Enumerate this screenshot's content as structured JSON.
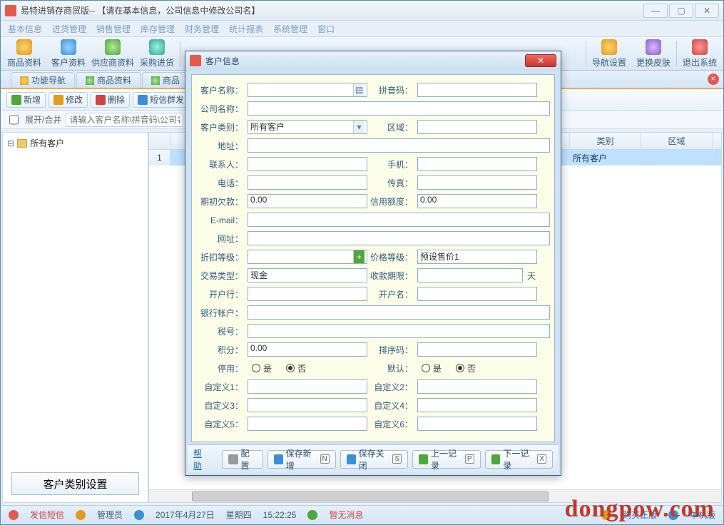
{
  "window": {
    "title": "易特进销存商贸版-- 【请在基本信息，公司信息中修改公司名】"
  },
  "menus": [
    "基本信息",
    "进货管理",
    "销售管理",
    "库存管理",
    "财务管理",
    "统计报表",
    "系统管理",
    "窗口"
  ],
  "toolbar": [
    {
      "label": "商品资料"
    },
    {
      "label": "客户资料"
    },
    {
      "label": "供应商资料"
    },
    {
      "label": "采购进货"
    },
    {
      "label": ""
    },
    {
      "label": ""
    },
    {
      "label": ""
    },
    {
      "label": ""
    },
    {
      "label": ""
    },
    {
      "label": ""
    },
    {
      "label": ""
    },
    {
      "label": "导航设置"
    },
    {
      "label": "更换皮肤"
    },
    {
      "label": "退出系统"
    }
  ],
  "tabs": [
    "功能导航",
    "商品资料",
    "商品"
  ],
  "subtool": {
    "add": "新增",
    "edit": "修改",
    "del": "删除",
    "sms": "短信群发"
  },
  "filter": {
    "expand": "展开/合并",
    "placeholder": "请输入客户名称\\拼音码\\公司名"
  },
  "tree": {
    "root": "所有客户",
    "button": "客户类别设置"
  },
  "grid": {
    "cols": [
      "",
      "",
      "",
      "",
      "类别",
      "区域"
    ],
    "row": {
      "idx": "1",
      "cat": "所有客户"
    }
  },
  "status": {
    "a": "发信短信",
    "b": "管理员",
    "date": "2017年4月27日",
    "week": "星期四",
    "time": "15:22:25",
    "msg": "暂无消息",
    "p1": "购买正版",
    "p2": "单机版"
  },
  "watermark": "dongpow.com",
  "dialog": {
    "title": "客户信息",
    "labels": {
      "name": "客户名称：",
      "pinyin": "拼音码：",
      "company": "公司名称：",
      "category": "客户类别：",
      "area": "区域：",
      "address": "地址：",
      "contact": "联系人：",
      "mobile": "手机：",
      "phone": "电话：",
      "fax": "传真：",
      "initdebt": "期初欠款：",
      "credit": "信用额度：",
      "email": "E-mail：",
      "url": "网址：",
      "discount": "折扣等级：",
      "pricelv": "价格等级：",
      "txtype": "交易类型：",
      "payperiod": "收款期限：",
      "bank": "开户行：",
      "acctname": "开户名：",
      "acctno": "银行帐户：",
      "taxno": "税号：",
      "points": "积分：",
      "sort": "排序码：",
      "disabled": "停用：",
      "default": "默认：",
      "c1": "自定义1：",
      "c2": "自定义2：",
      "c3": "自定义3：",
      "c4": "自定义4：",
      "c5": "自定义5：",
      "c6": "自定义6："
    },
    "values": {
      "category": "所有客户",
      "initdebt": "0.00",
      "credit": "0.00",
      "pricelv": "预设售价1",
      "txtype": "现金",
      "points": "0.00",
      "dayunit": "天",
      "yes": "是",
      "no": "否"
    },
    "footer": {
      "help": "帮助",
      "config": "配置",
      "savenew": "保存新增",
      "saveclose": "保存关闭",
      "prev": "上一记录",
      "next": "下一记录",
      "k_savenew": "N",
      "k_saveclose": "S",
      "k_prev": "P",
      "k_next": "X"
    }
  }
}
